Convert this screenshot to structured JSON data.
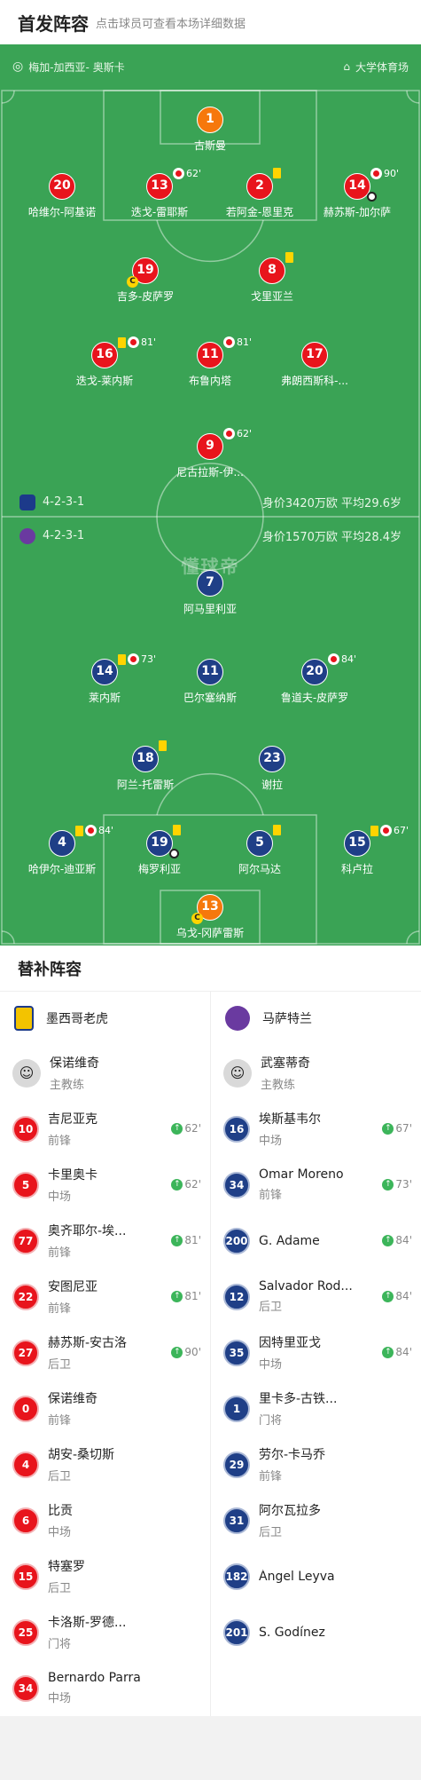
{
  "header": {
    "title": "首发阵容",
    "subtitle": "点击球员可查看本场详细数据"
  },
  "match_info": {
    "city": "梅加-加西亚- 奥斯卡",
    "venue": "大学体育场"
  },
  "watermark": "懂球帝",
  "home": {
    "formation": "4-2-3-1",
    "value_text": "身价3420万欧 平均29.6岁",
    "players": [
      {
        "num": "1",
        "name": "古斯曼",
        "gk": true
      },
      {
        "num": "20",
        "name": "哈维尔-阿基诺"
      },
      {
        "num": "13",
        "name": "迭戈-雷耶斯",
        "sub_off": "62'"
      },
      {
        "num": "2",
        "name": "若阿金-恩里克",
        "yellow": true
      },
      {
        "num": "14",
        "name": "赫苏斯-加尔萨",
        "sub_off": "90'",
        "goal": true
      },
      {
        "num": "19",
        "name": "吉多-皮萨罗",
        "captain": true
      },
      {
        "num": "8",
        "name": "戈里亚兰",
        "yellow": true
      },
      {
        "num": "16",
        "name": "迭戈-莱内斯",
        "yellow": true,
        "sub_off": "81'"
      },
      {
        "num": "11",
        "name": "布鲁内塔",
        "sub_off": "81'"
      },
      {
        "num": "17",
        "name": "弗朗西斯科-..."
      },
      {
        "num": "9",
        "name": "尼古拉斯-伊...",
        "sub_off": "62'"
      }
    ]
  },
  "away": {
    "formation": "4-2-3-1",
    "value_text": "身价1570万欧 平均28.4岁",
    "players": [
      {
        "num": "7",
        "name": "阿马里利亚"
      },
      {
        "num": "14",
        "name": "莱内斯",
        "yellow": true,
        "sub_off": "73'"
      },
      {
        "num": "11",
        "name": "巴尔塞纳斯"
      },
      {
        "num": "20",
        "name": "鲁道夫-皮萨罗",
        "sub_off": "84'"
      },
      {
        "num": "18",
        "name": "阿兰-托雷斯",
        "yellow": true
      },
      {
        "num": "23",
        "name": "谢拉"
      },
      {
        "num": "4",
        "name": "哈伊尔-迪亚斯",
        "yellow": true,
        "sub_off": "84'"
      },
      {
        "num": "19",
        "name": "梅罗利亚",
        "yellow": true,
        "goal": true
      },
      {
        "num": "5",
        "name": "阿尔马达",
        "yellow": true
      },
      {
        "num": "15",
        "name": "科卢拉",
        "yellow": true,
        "sub_off": "67'"
      },
      {
        "num": "13",
        "name": "乌戈-冈萨雷斯",
        "gk": true,
        "captain": true
      }
    ]
  },
  "subs_title": "替补阵容",
  "subs": {
    "home": {
      "team": "墨西哥老虎",
      "coach": {
        "name": "保诺维奇",
        "role": "主教练"
      },
      "players": [
        {
          "num": "10",
          "name": "吉尼亚克",
          "pos": "前锋",
          "in": "62'"
        },
        {
          "num": "5",
          "name": "卡里奥卡",
          "pos": "中场",
          "in": "62'"
        },
        {
          "num": "77",
          "name": "奥齐耶尔-埃...",
          "pos": "前锋",
          "in": "81'"
        },
        {
          "num": "22",
          "name": "安图尼亚",
          "pos": "前锋",
          "in": "81'"
        },
        {
          "num": "27",
          "name": "赫苏斯-安古洛",
          "pos": "后卫",
          "in": "90'"
        },
        {
          "num": "0",
          "name": "保诺维奇",
          "pos": "前锋"
        },
        {
          "num": "4",
          "name": "胡安-桑切斯",
          "pos": "后卫"
        },
        {
          "num": "6",
          "name": "比贡",
          "pos": "中场"
        },
        {
          "num": "15",
          "name": "特塞罗",
          "pos": "后卫"
        },
        {
          "num": "25",
          "name": "卡洛斯-罗德...",
          "pos": "门将"
        },
        {
          "num": "34",
          "name": "Bernardo Parra",
          "pos": "中场"
        }
      ]
    },
    "away": {
      "team": "马萨特兰",
      "coach": {
        "name": "武塞蒂奇",
        "role": "主教练"
      },
      "players": [
        {
          "num": "16",
          "name": "埃斯基韦尔",
          "pos": "中场",
          "in": "67'"
        },
        {
          "num": "34",
          "name": "Omar Moreno",
          "pos": "前锋",
          "in": "73'"
        },
        {
          "num": "200",
          "name": "G. Adame",
          "pos": "",
          "in": "84'"
        },
        {
          "num": "12",
          "name": "Salvador Rod...",
          "pos": "后卫",
          "in": "84'"
        },
        {
          "num": "35",
          "name": "因特里亚戈",
          "pos": "中场",
          "in": "84'"
        },
        {
          "num": "1",
          "name": "里卡多-古铁...",
          "pos": "门将"
        },
        {
          "num": "29",
          "name": "劳尔-卡马乔",
          "pos": "前锋"
        },
        {
          "num": "31",
          "name": "阿尔瓦拉多",
          "pos": "后卫"
        },
        {
          "num": "182",
          "name": "Ángel Leyva",
          "pos": ""
        },
        {
          "num": "201",
          "name": "S. Godínez",
          "pos": ""
        }
      ]
    }
  },
  "colors": {
    "pitch": "#3aa355",
    "home": "#e8141c",
    "away": "#1f3f87",
    "gk": "#f6780c",
    "yellow_card": "#ffd400",
    "sub_in": "#3cb55a"
  }
}
